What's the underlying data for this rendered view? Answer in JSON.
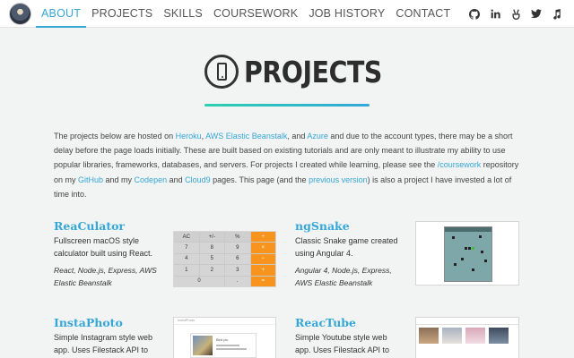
{
  "nav": {
    "links": [
      "ABOUT",
      "PROJECTS",
      "SKILLS",
      "COURSEWORK",
      "JOB HISTORY",
      "CONTACT"
    ],
    "active_index": 0,
    "social_icons": [
      "github-icon",
      "linkedin-icon",
      "angellist-icon",
      "twitter-icon",
      "music-icon"
    ]
  },
  "header": {
    "title": "PROJECTS",
    "icon": "mobile-phone-icon"
  },
  "intro": {
    "t1": "The projects below are hosted on ",
    "l1": "Heroku",
    "t2": ", ",
    "l2": "AWS Elastic Beanstalk",
    "t3": ", and ",
    "l3": "Azure",
    "t4": " and due to the account types, there may be a short delay before the page loads initially. These are built based on existing tutorials and are only meant to illustrate my ability to use popular libraries, frameworks, databases, and servers. For projects I created while learning, please see the ",
    "l4": "/coursework",
    "t5": " repository on my ",
    "l5": "GitHub",
    "t6": " and my ",
    "l6": "Codepen",
    "t7": " and ",
    "l7": "Cloud9",
    "t8": " pages. This page (and the ",
    "l8": "previous version",
    "t9": ") is also a project I have invested a lot of time into."
  },
  "projects": [
    {
      "title": "ReaCulator",
      "description": "Fullscreen macOS style calculator built using React.",
      "tech": "React, Node.js, Express, AWS Elastic Beanstalk",
      "calc_keys": [
        "AC",
        "+/-",
        "%",
        "÷",
        "7",
        "8",
        "9",
        "×",
        "4",
        "5",
        "6",
        "−",
        "1",
        "2",
        "3",
        "+",
        "0",
        ".",
        "="
      ]
    },
    {
      "title": "ngSnake",
      "description": "Classic Snake game created using Angular 4.",
      "tech": "Angular 4, Node.js, Express, AWS Elastic Beanstalk"
    },
    {
      "title": "InstaPhoto",
      "description": "Simple Instagram style web app. Uses Filestack API to",
      "tech": "",
      "thumb_header": "InstaPhoto",
      "thumb_caption": "Bird pic"
    },
    {
      "title": "ReacTube",
      "description": "Simple Youtube style web app. Uses Filestack API to",
      "tech": ""
    }
  ],
  "colors": {
    "accent": "#35a7d6",
    "gradient_start": "#2bd0b0",
    "calc_operator": "#f7941d",
    "snake_board": "#7ea7a9"
  }
}
